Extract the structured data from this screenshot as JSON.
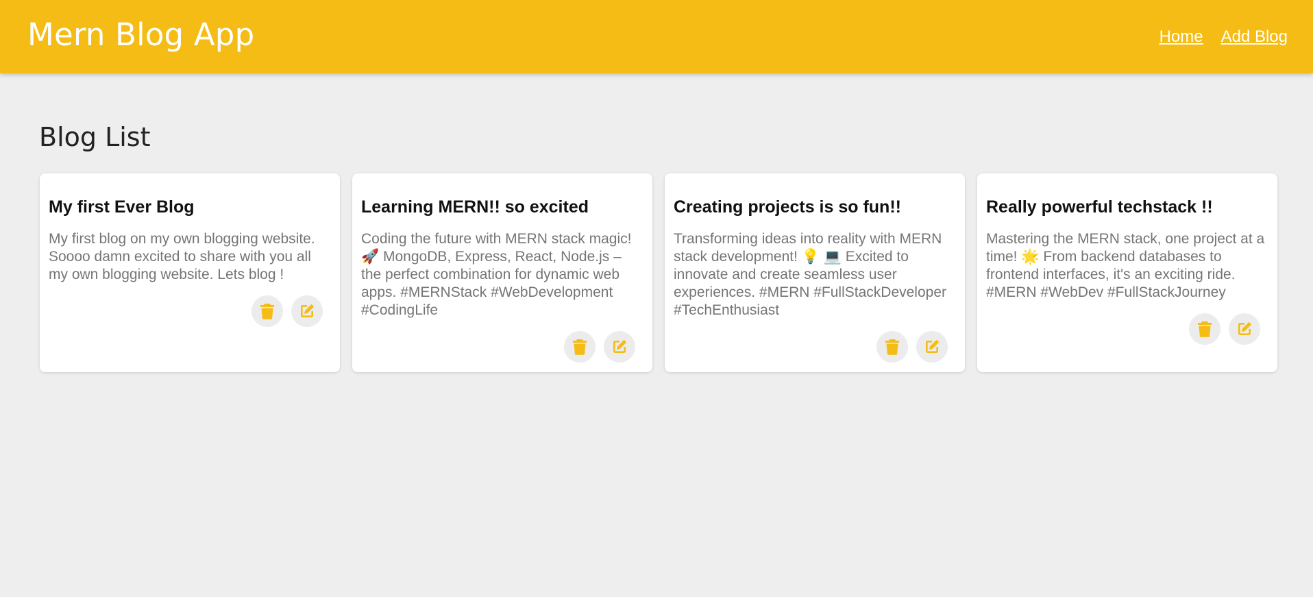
{
  "app": {
    "title": "Mern Blog App",
    "accent_color": "#f5bc16"
  },
  "nav": {
    "items": [
      {
        "label": "Home"
      },
      {
        "label": "Add Blog"
      }
    ]
  },
  "page": {
    "title": "Blog List"
  },
  "blogs": [
    {
      "title": "My first Ever Blog",
      "body": "My first blog on my own blogging website. Soooo damn excited to share with you all my own blogging website. Lets blog !",
      "actions": [
        "delete-icon",
        "edit-icon"
      ]
    },
    {
      "title": "Learning MERN!! so excited",
      "body": "Coding the future with MERN stack magic! 🚀 MongoDB, Express, React, Node.js – the perfect combination for dynamic web apps. #MERNStack #WebDevelopment #CodingLife",
      "actions": [
        "delete-icon",
        "edit-icon"
      ]
    },
    {
      "title": "Creating projects is so fun!!",
      "body": "Transforming ideas into reality with MERN stack development! 💡 💻 Excited to innovate and create seamless user experiences. #MERN #FullStackDeveloper #TechEnthusiast",
      "actions": [
        "delete-icon",
        "edit-icon"
      ]
    },
    {
      "title": "Really powerful techstack !!",
      "body": "Mastering the MERN stack, one project at a time! 🌟 From backend databases to frontend interfaces, it's an exciting ride. #MERN #WebDev #FullStackJourney",
      "actions": [
        "delete-icon",
        "edit-icon"
      ]
    }
  ]
}
